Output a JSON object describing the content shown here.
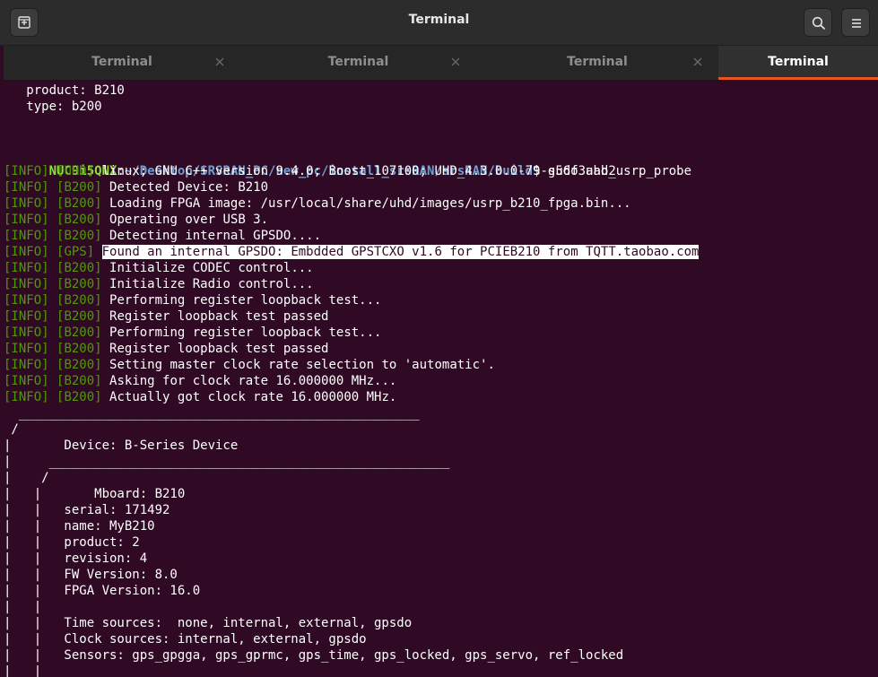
{
  "window": {
    "title": "Terminal"
  },
  "tabs": [
    {
      "label": "Terminal"
    },
    {
      "label": "Terminal"
    },
    {
      "label": "Terminal"
    },
    {
      "label": "Terminal"
    }
  ],
  "icons": {
    "new_tab": "new-tab-icon",
    "search": "search-icon",
    "menu": "hamburger-menu-icon",
    "tab_close": "close-icon"
  },
  "colors": {
    "terminal_bg": "#300a24",
    "titlebar_bg": "#2c2c2c",
    "info_green": "#4e9a06",
    "prompt_user": "#8ae234",
    "prompt_path": "#729fcf",
    "active_tab_accent": "#e95420"
  },
  "terminal": {
    "prev_product": "   product: B210",
    "prev_type": "   type: b200",
    "prompt_user": "NUC9i5QNX",
    "prompt_sep": ":",
    "prompt_path": "~/Desktop/SRSRAN_PC/new_pc/install_srsRAN/srsRAN/build",
    "prompt_cmd": "$ sudo uhd_usrp_probe",
    "log": [
      {
        "level": "[INFO]",
        "tag": "[UHD]",
        "msg": "linux; GNU C++ version 9.4.0; Boost_107100; UHD_4.3.0.0-79-g56f3aab2"
      },
      {
        "level": "[INFO]",
        "tag": "[B200]",
        "msg": "Detected Device: B210"
      },
      {
        "level": "[INFO]",
        "tag": "[B200]",
        "msg": "Loading FPGA image: /usr/local/share/uhd/images/usrp_b210_fpga.bin..."
      },
      {
        "level": "[INFO]",
        "tag": "[B200]",
        "msg": "Operating over USB 3."
      },
      {
        "level": "[INFO]",
        "tag": "[B200]",
        "msg": "Detecting internal GPSDO...."
      },
      {
        "level": "[INFO]",
        "tag": "[GPS]",
        "msg": "Found an internal GPSDO: Embdded GPSTCXO v1.6 for PCIEB210 from TQTT.taobao.com"
      },
      {
        "level": "[INFO]",
        "tag": "[B200]",
        "msg": "Initialize CODEC control..."
      },
      {
        "level": "[INFO]",
        "tag": "[B200]",
        "msg": "Initialize Radio control..."
      },
      {
        "level": "[INFO]",
        "tag": "[B200]",
        "msg": "Performing register loopback test..."
      },
      {
        "level": "[INFO]",
        "tag": "[B200]",
        "msg": "Register loopback test passed"
      },
      {
        "level": "[INFO]",
        "tag": "[B200]",
        "msg": "Performing register loopback test..."
      },
      {
        "level": "[INFO]",
        "tag": "[B200]",
        "msg": "Register loopback test passed"
      },
      {
        "level": "[INFO]",
        "tag": "[B200]",
        "msg": "Setting master clock rate selection to 'automatic'."
      },
      {
        "level": "[INFO]",
        "tag": "[B200]",
        "msg": "Asking for clock rate 16.000000 MHz..."
      },
      {
        "level": "[INFO]",
        "tag": "[B200]",
        "msg": "Actually got clock rate 16.000000 MHz."
      }
    ],
    "tree": [
      "  _____________________________________________________",
      " /",
      "|       Device: B-Series Device",
      "|     _____________________________________________________",
      "|    /",
      "|   |       Mboard: B210",
      "|   |   serial: 171492",
      "|   |   name: MyB210",
      "|   |   product: 2",
      "|   |   revision: 4",
      "|   |   FW Version: 8.0",
      "|   |   FPGA Version: 16.0",
      "|   |",
      "|   |   Time sources:  none, internal, external, gpsdo",
      "|   |   Clock sources: internal, external, gpsdo",
      "|   |   Sensors: gps_gpgga, gps_gprmc, gps_time, gps_locked, gps_servo, ref_locked",
      "|   |"
    ]
  }
}
